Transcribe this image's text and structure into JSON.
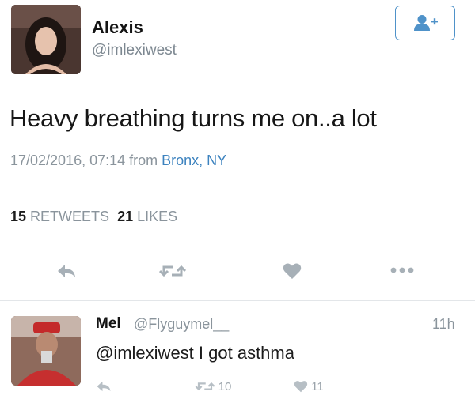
{
  "tweet": {
    "author_name": "Alexis",
    "author_handle": "@imlexiwest",
    "follow_icon": "add-user-icon",
    "text": "Heavy breathing turns me on..a lot",
    "timestamp": "17/02/2016, 07:14 from ",
    "location": "Bronx, NY",
    "retweets_count": "15",
    "retweets_label": "RETWEETS",
    "likes_count": "21",
    "likes_label": "LIKES",
    "actions": [
      "reply-icon",
      "retweet-icon",
      "heart-icon",
      "more-icon"
    ]
  },
  "reply": {
    "author_name": "Mel",
    "author_handle": "@Flyguymel__",
    "time": "11h",
    "mention": "@imlexiwest",
    "text": " I got asthma",
    "retweet_count": "10",
    "like_count": "11"
  },
  "colors": {
    "accent": "#3d83bf",
    "muted": "#8a949c",
    "icon": "#a7b0b7",
    "divider": "#e3e6e9"
  }
}
